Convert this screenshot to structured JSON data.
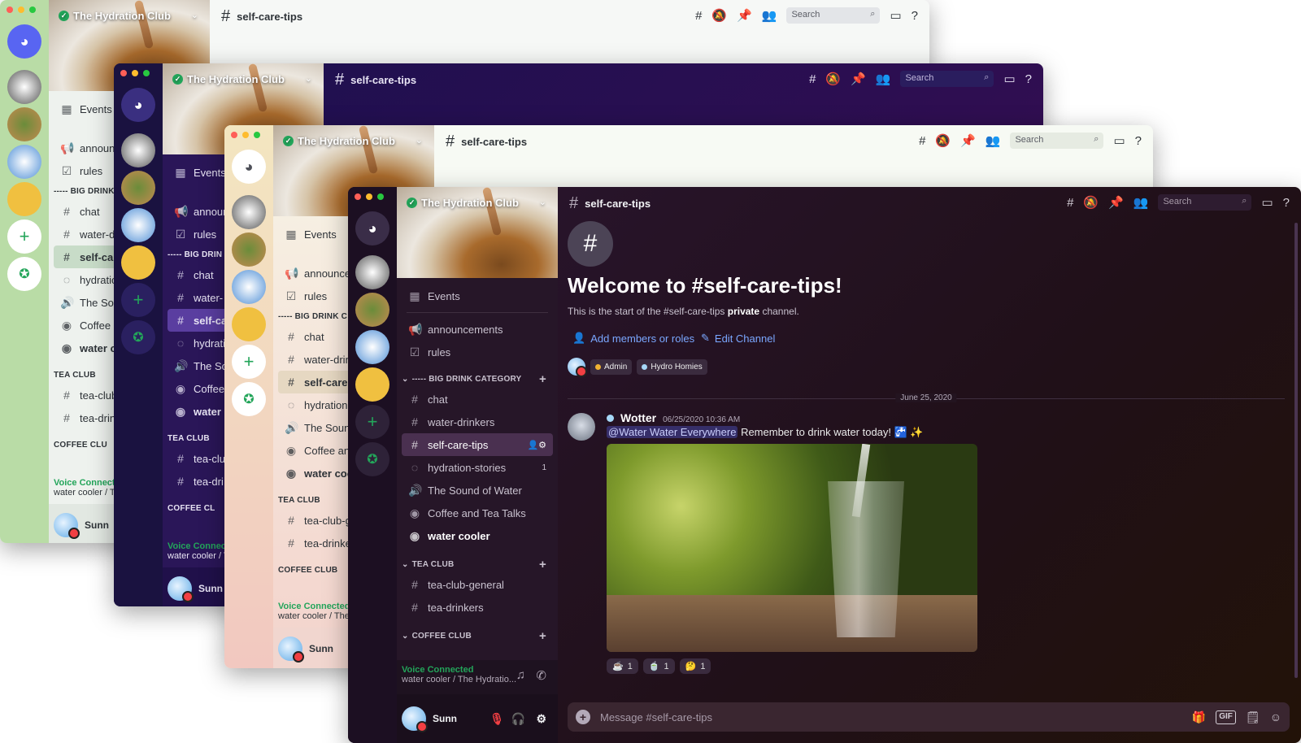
{
  "server_name": "The Hydration Club",
  "channel": "self-care-tips",
  "search_placeholder": "Search",
  "events_label": "Events",
  "channels": {
    "announcements": "announcements",
    "rules": "rules",
    "cat_big": "----- BIG DRINK CATEGORY",
    "chat": "chat",
    "water_drinkers": "water-drinkers",
    "self_care": "self-care-tips",
    "hydration": "hydration-stories",
    "hydration_badge": "1",
    "sound": "The Sound of Water",
    "coffee_tea": "Coffee and Tea Talks",
    "water_cooler": "water cooler",
    "cat_tea": "TEA CLUB",
    "tea_general": "tea-club-general",
    "tea_drinkers": "tea-drinkers",
    "cat_coffee": "COFFEE CLUB"
  },
  "back_windows": {
    "w1": {
      "announcements": "announcem",
      "cat_big": "----- BIG DRINK",
      "water_drinkers": "water-dri",
      "self_care": "self-care",
      "hydration": "hydratio",
      "sound": "The Soun",
      "coffee": "Coffee a",
      "water_cooler": "water co",
      "tea_general": "tea-club",
      "tea_drinkers": "tea-drin",
      "cat_coffee": "COFFEE CLU",
      "voice_sub": "water cooler / Th"
    },
    "w2": {
      "announcements": "announ",
      "cat_big": "----- BIG DRIN",
      "water_drinkers": "water-",
      "self_care": "self-ca",
      "hydration": "hydrati",
      "sound": "The So",
      "coffee": "Coffee",
      "water_cooler": "water c",
      "tea_general": "tea-clu",
      "tea_drinkers": "tea-dri",
      "cat_coffee": "COFFEE CL",
      "voice_sub": "water cooler / Th"
    },
    "w3": {
      "announcements": "announce",
      "cat_big": "----- BIG DRINK C",
      "water_drinkers": "water-drin",
      "self_care": "self-care-",
      "hydration": "hydration-",
      "sound": "The Sound",
      "coffee": "Coffee and",
      "water_cooler": "water coo",
      "tea_general": "tea-club-g",
      "tea_drinkers": "tea-drinke",
      "cat_coffee": "COFFEE CLUB",
      "voice_sub": "water cooler / The H"
    }
  },
  "voice": {
    "status": "Voice Connected",
    "sub": "water cooler / The Hydratio..."
  },
  "user": {
    "name": "Sunn"
  },
  "welcome": {
    "title": "Welcome to #self-care-tips!",
    "sub_prefix": "This is the start of the #self-care-tips",
    "sub_bold": "private",
    "sub_suffix": "channel.",
    "add_members": "Add members or roles",
    "edit_channel": "Edit Channel",
    "roles": [
      {
        "name": "Admin",
        "color": "#f0b232"
      },
      {
        "name": "Hydro Homies",
        "color": "#a6d8f7"
      }
    ]
  },
  "date_divider": "June 25, 2020",
  "message": {
    "author": "Wotter",
    "timestamp": "06/25/2020 10:36 AM",
    "mention": "@Water Water Everywhere",
    "text": "Remember to drink water today! 🚰 ✨",
    "reactions": [
      {
        "emoji": "☕",
        "count": "1"
      },
      {
        "emoji": "🍵",
        "count": "1"
      },
      {
        "emoji": "🤔",
        "count": "1"
      }
    ]
  },
  "composer_placeholder": "Message #self-care-tips",
  "gif_label": "GIF",
  "colors": {
    "accent": "#5865f2",
    "online": "#23a55a",
    "link": "#7aa7ff"
  }
}
